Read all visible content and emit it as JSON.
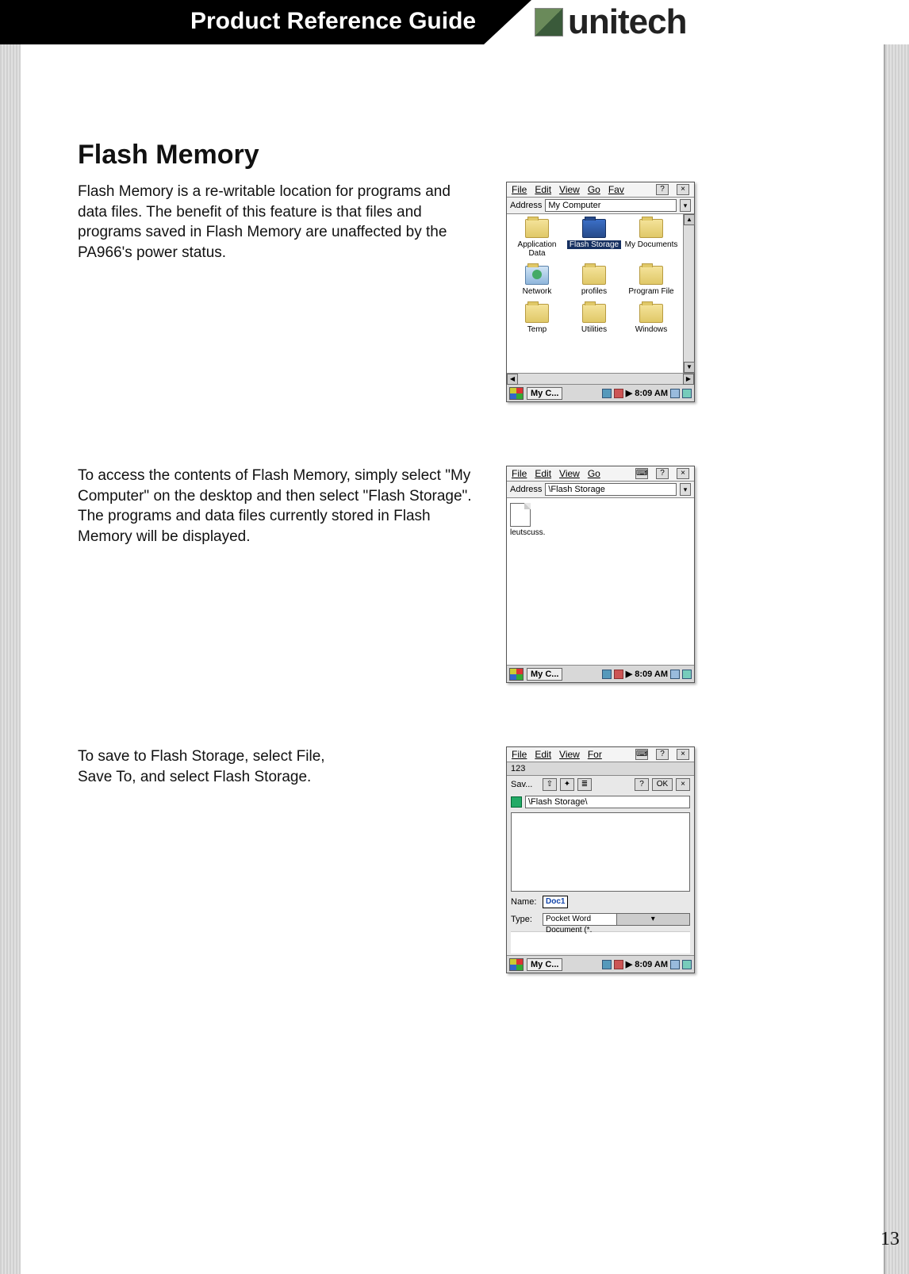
{
  "header": {
    "title": "Product Reference Guide",
    "brand": "unitech"
  },
  "section": {
    "heading": "Flash Memory",
    "para1": "Flash Memory is a re-writable location for programs and data files.  The benefit of this feature is that files and programs saved in Flash Memory are unaffected by the PA966's power status.",
    "para2": "To access the contents of Flash Memory, simply select \"My Computer\" on the desktop and then select \"Flash Storage\". The programs and data files currently stored in Flash Memory will be displayed.",
    "para3": "To save to Flash Storage, select File, Save To, and select Flash Storage."
  },
  "pageNumber": "13",
  "shot1": {
    "menus": [
      "File",
      "Edit",
      "View",
      "Go",
      "Fav"
    ],
    "closeX": "×",
    "addressLabel": "Address",
    "addressValue": "My Computer",
    "dropdownGlyph": "▾",
    "folders": [
      {
        "label": "Application Data",
        "type": "folder"
      },
      {
        "label": "Flash Storage",
        "type": "selected"
      },
      {
        "label": "My Documents",
        "type": "folder"
      },
      {
        "label": "Network",
        "type": "net"
      },
      {
        "label": "profiles",
        "type": "folder"
      },
      {
        "label": "Program File",
        "type": "folder"
      },
      {
        "label": "Temp",
        "type": "folder"
      },
      {
        "label": "Utilities",
        "type": "folder"
      },
      {
        "label": "Windows",
        "type": "folder"
      }
    ],
    "taskLabel": "My C...",
    "clock": "8:09 AM"
  },
  "shot2": {
    "menus": [
      "File",
      "Edit",
      "View",
      "Go"
    ],
    "addressLabel": "Address",
    "addressValue": "\\Flash Storage",
    "fileLabel": "leutscuss.",
    "taskLabel": "My C...",
    "clock": "8:09 AM"
  },
  "shot3": {
    "menus": [
      "File",
      "Edit",
      "View",
      "For"
    ],
    "title": "123",
    "savRowLabel": "Sav...",
    "okLabel": "OK",
    "helpLabel": "?",
    "pathValue": "\\Flash Storage\\",
    "nameLabel": "Name:",
    "nameValue": "Doc1",
    "typeLabel": "Type:",
    "typeValue": "Pocket Word Document (*.",
    "taskLabel": "My C...",
    "clock": "8:09 AM",
    "upGlyph": "⇧",
    "newGlyph": "✦",
    "listGlyph": "≣"
  },
  "glyphs": {
    "scrollUp": "▲",
    "scrollDown": "▼",
    "scrollLeft": "◀",
    "scrollRight": "▶",
    "kbd": "⌨",
    "desk": "≡"
  }
}
